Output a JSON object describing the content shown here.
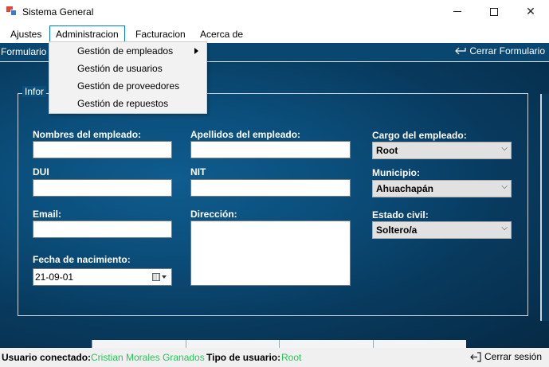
{
  "window": {
    "title": "Sistema General",
    "icon": "app-icon"
  },
  "menubar": {
    "items": [
      {
        "label": "Ajustes"
      },
      {
        "label": "Administracion"
      },
      {
        "label": "Facturacion"
      },
      {
        "label": "Acerca de"
      }
    ]
  },
  "dropdown": {
    "items": [
      {
        "label": "Gestión de empleados",
        "has_submenu": true
      },
      {
        "label": "Gestión de usuarios"
      },
      {
        "label": "Gestión de proveedores"
      },
      {
        "label": "Gestión de repuestos"
      }
    ]
  },
  "form_bar": {
    "title": "Formulario",
    "close_label": "Cerrar Formulario",
    "close_icon": "back-arrow-icon"
  },
  "form": {
    "group_title": "Infor",
    "nombres_label": "Nombres del empleado:",
    "nombres_value": "",
    "apellidos_label": "Apellidos del empleado:",
    "apellidos_value": "",
    "cargo_label": "Cargo del empleado:",
    "cargo_value": "Root",
    "dui_label": "DUI",
    "dui_value": "",
    "nit_label": "NIT",
    "nit_value": "",
    "municipio_label": "Municipio:",
    "municipio_value": "Ahuachapán",
    "email_label": "Email:",
    "email_value": "",
    "direccion_label": "Dirección:",
    "direccion_value": "",
    "estado_label": "Estado civil:",
    "estado_value": "Soltero/a",
    "fecha_label": "Fecha de nacimiento:",
    "fecha_value": "21-09-01"
  },
  "statusbar": {
    "user_label": "Usuario conectado:",
    "user_value": "Cristian Morales Granados",
    "type_label": "Tipo de usuario:",
    "type_value": "Root",
    "logout_label": "Cerrar sesión",
    "logout_icon": "logout-icon"
  },
  "colors": {
    "background_dark": "#0b4f7c",
    "status_value": "#22c85a",
    "menu_highlight": "#0078d7"
  }
}
